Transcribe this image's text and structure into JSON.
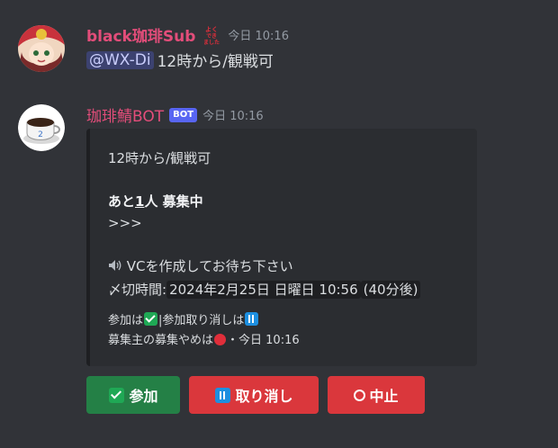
{
  "messages": [
    {
      "username": "black珈琲Sub",
      "timestamp": "今日 10:16",
      "badge_icon": "kana-badge-icon",
      "mention": "@WX-Di",
      "text": "12時から/観戦可"
    },
    {
      "username": "珈琲鯖BOT",
      "bot_tag": "BOT",
      "timestamp": "今日 10:16"
    }
  ],
  "embed": {
    "title_line": "12時から/観戦可",
    "recruit_prefix": "あと",
    "recruit_count": "1",
    "recruit_suffix": "人 募集中",
    "arrows": ">>>",
    "vc_line": "VCを作成してお待ち下さい",
    "deadline_label": "〆切時間:",
    "deadline_value": "2024年2月25日 日曜日 10:56",
    "deadline_relative": "(40分後)",
    "join_text_a": "参加は",
    "join_text_b": "|参加取り消しは",
    "owner_text": "募集主の募集やめは",
    "footer_time": "・今日 10:16"
  },
  "buttons": {
    "join": "参加",
    "cancel": "取り消し",
    "stop": "中止"
  },
  "colors": {
    "background": "#313338",
    "embed_bg": "#2b2d31",
    "username": "#e34d7a",
    "join_button": "#248046",
    "danger_button": "#da373c",
    "bot_tag": "#5865f2"
  }
}
